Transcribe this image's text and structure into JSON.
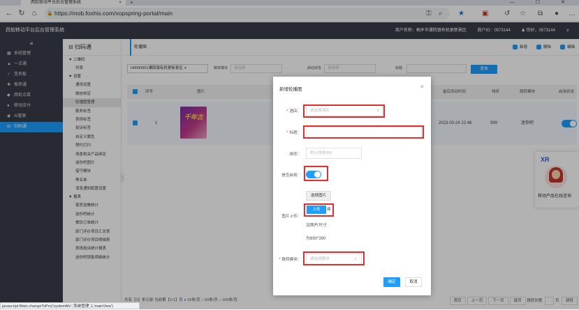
{
  "browser": {
    "tab_title": "西软移动平台后台管理系统",
    "tab_close": "×",
    "new_tab": "+",
    "window_controls": "—  ☐  ✕",
    "url_prefix": "https://",
    "url": "mob.foxhis.com/xopspring-portal/main"
  },
  "header": {
    "title": "西软移动平台后台管理系统",
    "merchant": "商户名称：桐乡市濮院镇有机更新景区",
    "merchant_id": "商户ID：0573144",
    "user": "你好，0573144"
  },
  "sidebar": {
    "toggle": "≡",
    "items": [
      {
        "icon": "▦",
        "label": "系统管理"
      },
      {
        "icon": "▲",
        "label": "一点通"
      },
      {
        "icon": "✓",
        "label": "签名板"
      },
      {
        "icon": "✚",
        "label": "客房通"
      },
      {
        "icon": "◆",
        "label": "西软点菜"
      },
      {
        "icon": "●",
        "label": "移动支付"
      },
      {
        "icon": "◉",
        "label": "AI管家"
      },
      {
        "icon": "⊟",
        "label": "扫码通"
      }
    ],
    "active_index": 7
  },
  "submenu": {
    "title": "扫码通",
    "groups": [
      {
        "label": "▼ 二维码",
        "items": [
          "列表"
        ]
      },
      {
        "label": "▼ 设置",
        "items": [
          "通用设置",
          "微信绑定",
          "轮播图管理",
          "服务标签",
          "表扬标签",
          "投诉标签",
          "自定义属性",
          "预约打扫",
          "场景相关产品绑定",
          "迷你吧图片",
          "借守模块",
          "黑名单",
          "消息通知配置设置"
        ]
      },
      {
        "label": "▼ 报表",
        "items": [
          "客房送餐统计",
          "迷你吧统计",
          "餐饮订单统计",
          "部门评价项目汇总表",
          "部门评价项目明细表",
          "表扬投诉统计报表",
          "迷你吧销售明细统计"
        ]
      }
    ],
    "active_item": "轮播图管理"
  },
  "main": {
    "crumb": "轮播图",
    "actions": {
      "add": "新增",
      "delete": "删除",
      "edit": "编辑"
    },
    "filters": {
      "hotel_value": "H0000001濮院镇有机更新景区",
      "module_label": "跳转模块",
      "module_placeholder": "请选择",
      "status_label": "启动状态",
      "status_placeholder": "请选择",
      "title_label": "标题",
      "query": "查询"
    },
    "columns": [
      "序号",
      "图片",
      "最后改动时间",
      "排序",
      "跳转模块",
      "启用状态"
    ],
    "row": {
      "index": "1",
      "updated": "2023-03-24 22:48",
      "order": "999",
      "module": "迷你吧",
      "thumb_text": "千年古"
    }
  },
  "modal": {
    "title": "新增轮播图",
    "close": "×",
    "hotel_label": "酒店：",
    "hotel_placeholder": "请选择酒店",
    "title_label": "标题：",
    "order_label": "排序：",
    "order_placeholder": "默认排序999",
    "enabled_label": "是否启用：",
    "pick_button": "选择图片",
    "image_label": "图片上传：",
    "upload_button": "上传",
    "upload_tail": "建",
    "hint_size": "议图片尺寸",
    "hint_dims": "为690*390",
    "module_label": "跳转模块：",
    "module_placeholder": "请选择模块",
    "confirm": "确定",
    "cancel": "取消"
  },
  "chat_widget": {
    "logo": "XR",
    "label": "移动产品在线咨询"
  },
  "pagination": {
    "summary": "共有【1】条记录  当前第【1/1】页",
    "per_page_options": [
      "15条/页",
      "50条/页",
      "100条/页"
    ],
    "buttons": [
      "首页",
      "上一页",
      "下一页",
      "尾页"
    ],
    "jump_label": "跳转到第",
    "jump_suffix": "页",
    "jump_btn": "跳转"
  },
  "statusbar": "javascript:Main.changeToPro('systemMo','系统管理',1,'mainView')",
  "colors": {
    "accent": "#1e9fff",
    "header_bg": "#393d49",
    "highlight_red": "#e52b2b"
  }
}
